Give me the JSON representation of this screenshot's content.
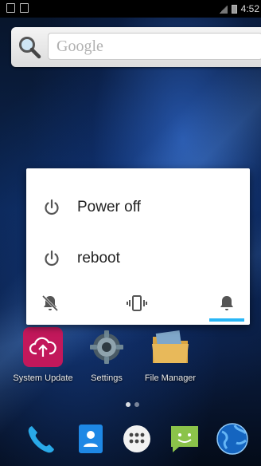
{
  "status_bar": {
    "time": "4:52"
  },
  "search": {
    "placeholder": "Google"
  },
  "power_menu": {
    "items": [
      {
        "label": "Power off",
        "icon": "power-icon"
      },
      {
        "label": "reboot",
        "icon": "power-icon"
      }
    ],
    "sound_modes": [
      {
        "name": "mute",
        "icon": "bell-off-icon",
        "selected": false
      },
      {
        "name": "vibrate",
        "icon": "vibrate-icon",
        "selected": false
      },
      {
        "name": "sound",
        "icon": "bell-icon",
        "selected": true
      }
    ],
    "accent_color": "#29b6f6"
  },
  "apps": [
    {
      "label": "System Update",
      "icon": "cloud-upload-icon",
      "color": "#c2185b"
    },
    {
      "label": "Settings",
      "icon": "gear-icon"
    },
    {
      "label": "File Manager",
      "icon": "folder-icon"
    }
  ],
  "dock": [
    {
      "name": "Phone",
      "icon": "phone-icon"
    },
    {
      "name": "Contacts",
      "icon": "contacts-icon"
    },
    {
      "name": "All apps",
      "icon": "app-drawer-icon"
    },
    {
      "name": "Messaging",
      "icon": "messaging-icon"
    },
    {
      "name": "Browser",
      "icon": "globe-icon"
    }
  ]
}
